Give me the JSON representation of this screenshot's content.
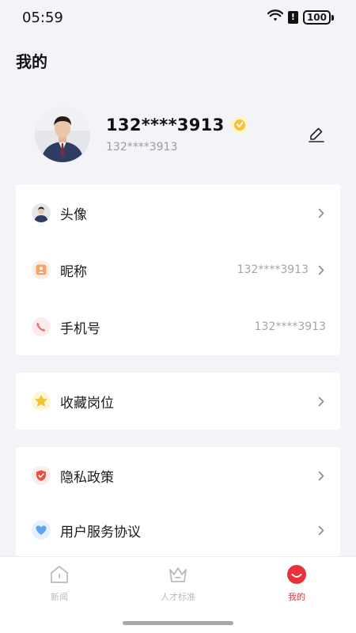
{
  "status_bar": {
    "time": "05:59",
    "battery": "100"
  },
  "page": {
    "title": "我的"
  },
  "profile": {
    "name": "132****3913",
    "sub": "132****3913"
  },
  "account_card": {
    "items": [
      {
        "label": "头像",
        "value": "",
        "icon": "avatar-thumb-icon"
      },
      {
        "label": "昵称",
        "value": "132****3913",
        "icon": "nickname-icon"
      },
      {
        "label": "手机号",
        "value": "132****3913",
        "icon": "phone-icon"
      }
    ]
  },
  "favorites_card": {
    "items": [
      {
        "label": "收藏岗位",
        "icon": "star-icon"
      }
    ]
  },
  "policy_card": {
    "items": [
      {
        "label": "隐私政策",
        "icon": "shield-icon"
      },
      {
        "label": "用户服务协议",
        "icon": "heart-icon"
      }
    ]
  },
  "bottom_nav": {
    "items": [
      {
        "label": "新闻",
        "icon": "home-icon"
      },
      {
        "label": "人才标准",
        "icon": "crown-icon"
      },
      {
        "label": "我的",
        "icon": "me-icon"
      }
    ]
  },
  "colors": {
    "accent": "#e8333a",
    "background": "#f3f4f8",
    "muted_text": "#a3a5ab"
  }
}
